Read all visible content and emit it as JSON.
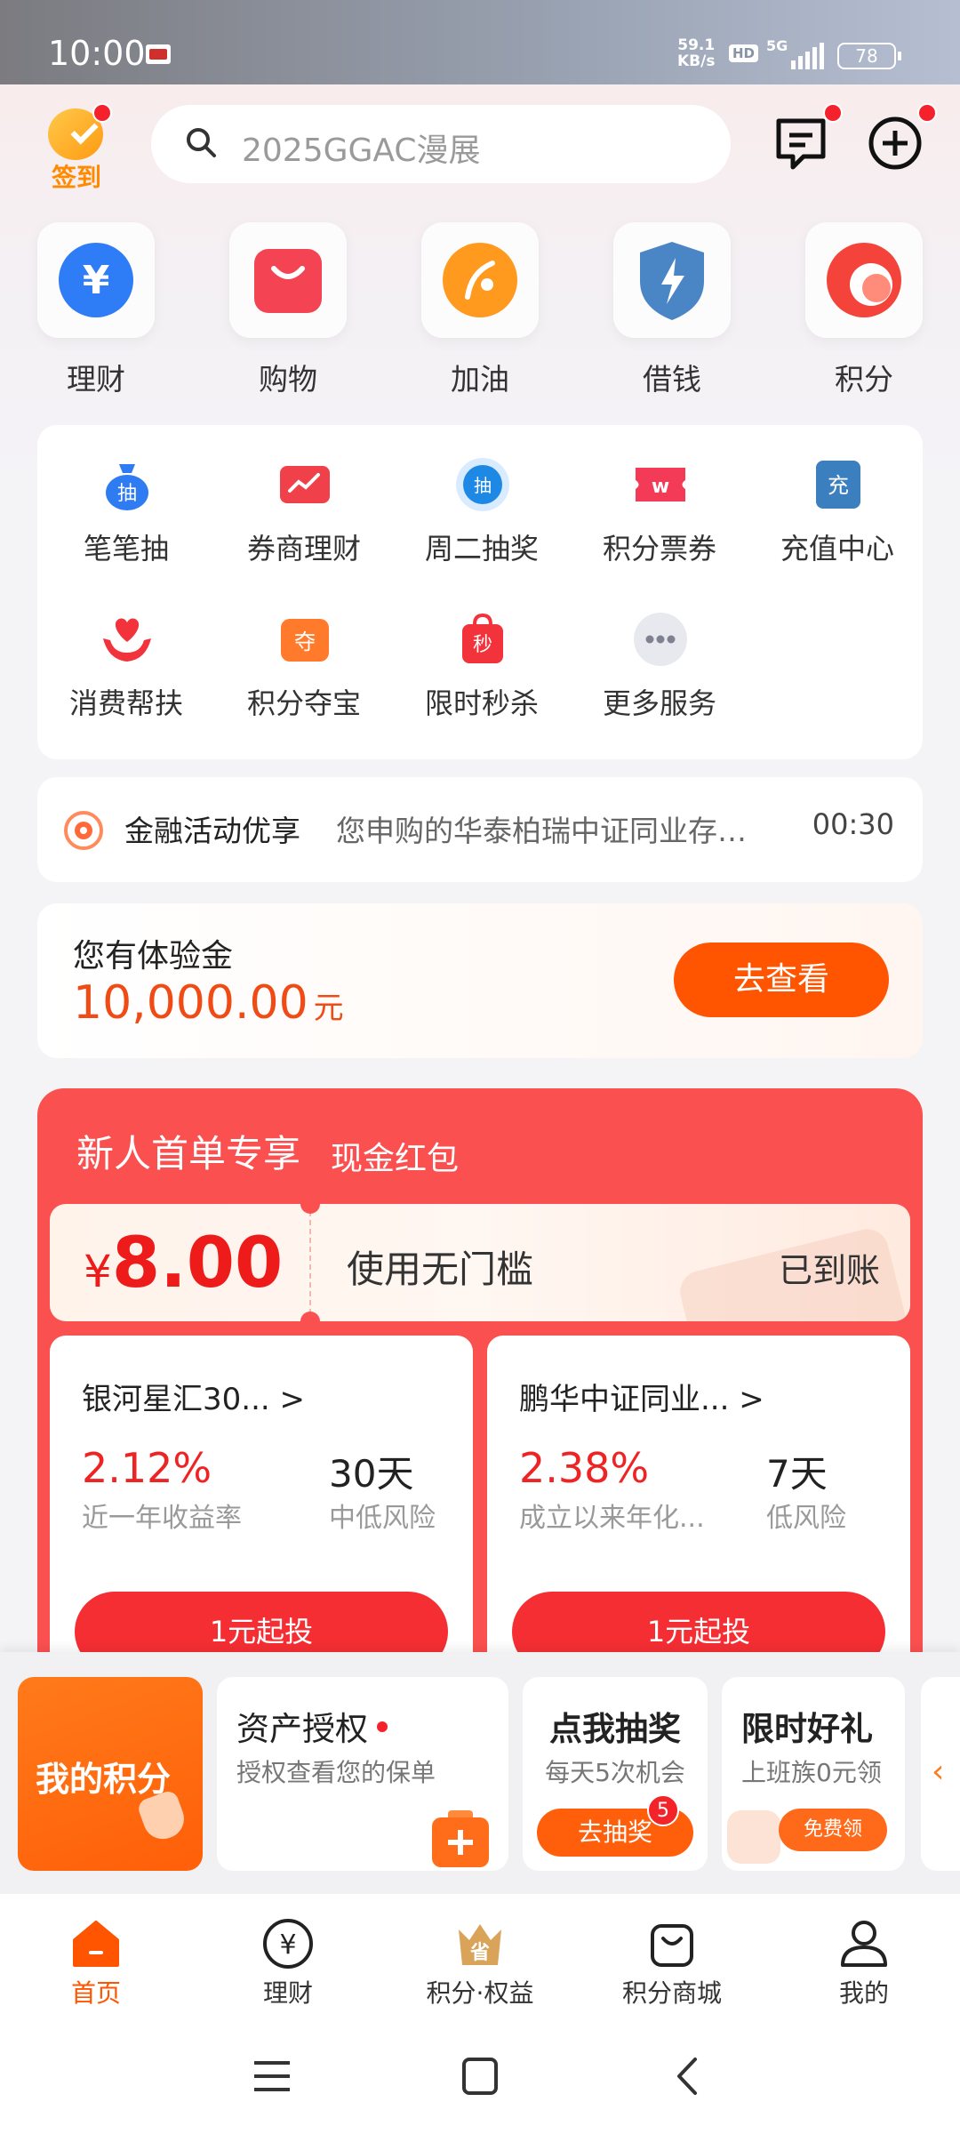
{
  "status_bar": {
    "time": "10:00",
    "net_speed_value": "59.1",
    "net_speed_unit": "KB/s",
    "hd": "HD",
    "network": "5G",
    "battery": "78"
  },
  "header": {
    "signin_label": "签到",
    "search_placeholder": "2025GGAC漫展"
  },
  "quick_entries": [
    {
      "label": "理财",
      "icon": "yen-icon"
    },
    {
      "label": "购物",
      "icon": "shopping-bag-icon"
    },
    {
      "label": "加油",
      "icon": "fuel-icon"
    },
    {
      "label": "借钱",
      "icon": "shield-bolt-icon"
    },
    {
      "label": "积分",
      "icon": "points-icon"
    }
  ],
  "services": [
    {
      "label": "笔笔抽",
      "icon_text": "抽"
    },
    {
      "label": "券商理财",
      "icon_text": ""
    },
    {
      "label": "周二抽奖",
      "icon_text": "抽"
    },
    {
      "label": "积分票券",
      "icon_text": ""
    },
    {
      "label": "充值中心",
      "icon_text": "充"
    },
    {
      "label": "消费帮扶",
      "icon_text": ""
    },
    {
      "label": "积分夺宝",
      "icon_text": "夺"
    },
    {
      "label": "限时秒杀",
      "icon_text": "秒"
    },
    {
      "label": "更多服务",
      "icon_text": ""
    }
  ],
  "notice": {
    "title": "金融活动优享",
    "text": "您申购的华泰柏瑞中证同业存…",
    "time": "00:30"
  },
  "experience": {
    "title": "您有体验金",
    "amount": "10,000.00",
    "unit": "元",
    "button": "去查看"
  },
  "promo": {
    "title": "新人首单专享",
    "subtitle": "现金红包",
    "coupon": {
      "currency": "¥",
      "amount": "8.00",
      "desc": "使用无门槛",
      "status": "已到账"
    },
    "funds": [
      {
        "name": "银河星汇30... >",
        "rate": "2.12%",
        "rate_label": "近一年收益率",
        "days": "30天",
        "risk": "中低风险",
        "button": "1元起投"
      },
      {
        "name": "鹏华中证同业... >",
        "rate": "2.38%",
        "rate_label": "成立以来年化...",
        "days": "7天",
        "risk": "低风险",
        "button": "1元起投"
      }
    ]
  },
  "bottom_strip": {
    "my_points": "我的积分",
    "auth": {
      "title": "资产授权",
      "subtitle": "授权查看您的保单"
    },
    "lottery": {
      "title": "点我抽奖",
      "subtitle": "每天5次机会",
      "button": "去抽奖",
      "badge": "5"
    },
    "gift": {
      "title": "限时好礼",
      "subtitle": "上班族0元领",
      "button": "免费领"
    }
  },
  "tabbar": [
    {
      "label": "首页",
      "active": true
    },
    {
      "label": "理财",
      "active": false
    },
    {
      "label": "积分·权益",
      "active": false
    },
    {
      "label": "积分商城",
      "active": false
    },
    {
      "label": "我的",
      "active": false
    }
  ],
  "colors": {
    "accent": "#ff5500",
    "promo_red": "#fb5050",
    "rate_red": "#ee2323",
    "active_tab": "#ff5500"
  }
}
